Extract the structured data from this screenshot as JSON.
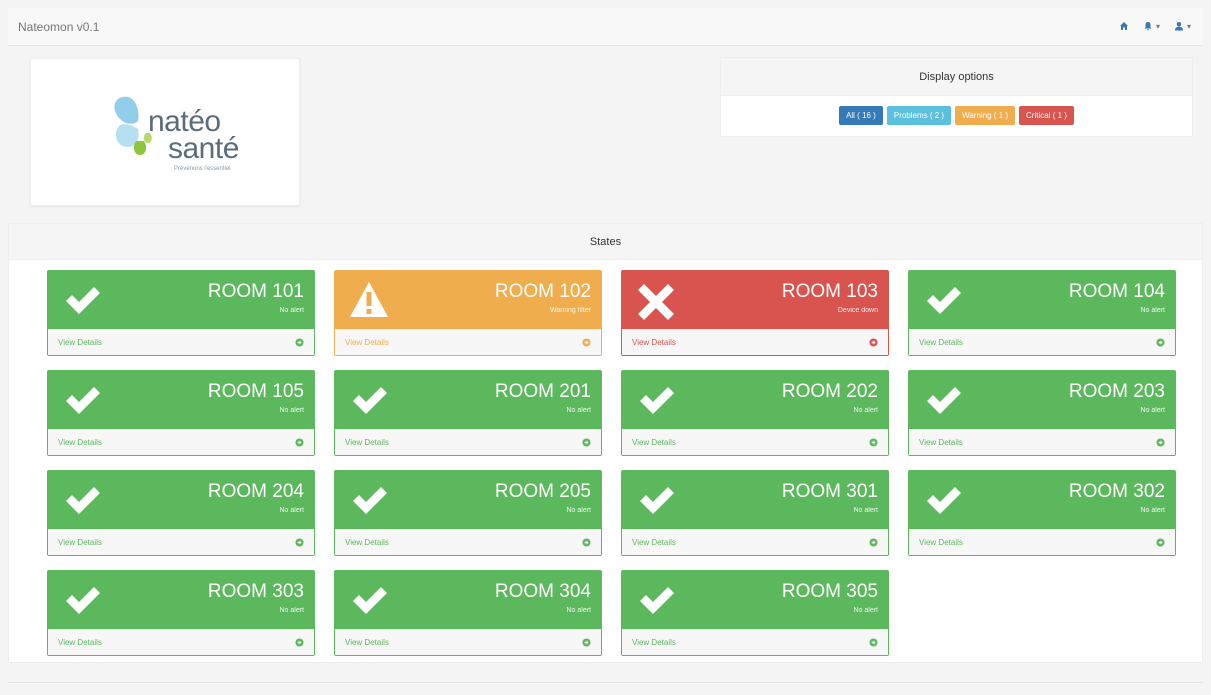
{
  "navbar": {
    "brand": "Nateomon v0.1",
    "icons": [
      "home-icon",
      "notification-icon",
      "user-icon"
    ],
    "accent_color": "#337ab7"
  },
  "logo": {
    "line1": "natéo",
    "line2": "santé",
    "tagline": "Prévenons l'essentiel"
  },
  "display_options": {
    "title": "Display options",
    "filters": [
      {
        "label": "All ( 16 )",
        "color": "#337ab7"
      },
      {
        "label": "Problems ( 2 )",
        "color": "#5bc0de"
      },
      {
        "label": "Warning ( 1 )",
        "color": "#f0ad4e"
      },
      {
        "label": "Critical ( 1 )",
        "color": "#d9534f"
      }
    ]
  },
  "states": {
    "title": "States",
    "view_details_label": "View Details",
    "colors": {
      "ok": "#5cb85c",
      "warning": "#f0ad4e",
      "critical": "#d9534f"
    },
    "rooms": [
      {
        "name": "ROOM 101",
        "status": "No alert",
        "level": "ok"
      },
      {
        "name": "ROOM 102",
        "status": "Warning filter",
        "level": "warning"
      },
      {
        "name": "ROOM 103",
        "status": "Device down",
        "level": "critical"
      },
      {
        "name": "ROOM 104",
        "status": "No alert",
        "level": "ok"
      },
      {
        "name": "ROOM 105",
        "status": "No alert",
        "level": "ok"
      },
      {
        "name": "ROOM 201",
        "status": "No alert",
        "level": "ok"
      },
      {
        "name": "ROOM 202",
        "status": "No alert",
        "level": "ok"
      },
      {
        "name": "ROOM 203",
        "status": "No alert",
        "level": "ok"
      },
      {
        "name": "ROOM 204",
        "status": "No alert",
        "level": "ok"
      },
      {
        "name": "ROOM 205",
        "status": "No alert",
        "level": "ok"
      },
      {
        "name": "ROOM 301",
        "status": "No alert",
        "level": "ok"
      },
      {
        "name": "ROOM 302",
        "status": "No alert",
        "level": "ok"
      },
      {
        "name": "ROOM 303",
        "status": "No alert",
        "level": "ok"
      },
      {
        "name": "ROOM 304",
        "status": "No alert",
        "level": "ok"
      },
      {
        "name": "ROOM 305",
        "status": "No alert",
        "level": "ok"
      }
    ]
  }
}
